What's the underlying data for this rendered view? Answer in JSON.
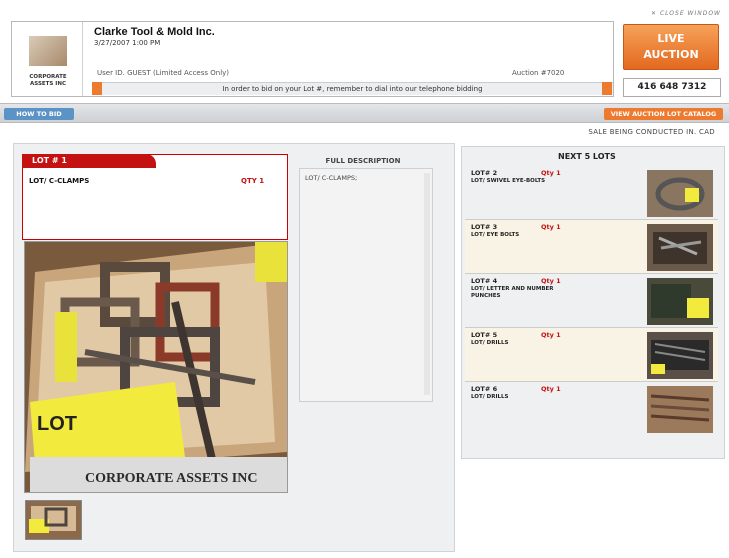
{
  "window": {
    "close_label": "✕ CLOSE WINDOW"
  },
  "header": {
    "company": "Clarke Tool & Mold Inc.",
    "datetime": "3/27/2007 1:00 PM",
    "user_id": "User ID. GUEST (Limited Access Only)",
    "auction_no": "Auction #7020",
    "notice": "In order to bid on your Lot #, remember to dial into our telephone bidding",
    "logo_name": "CORPORATE ASSETS INC",
    "live_auction_line1": "LIVE",
    "live_auction_line2": "AUCTION",
    "phone": "416 648 7312"
  },
  "nav": {
    "how_to_bid": "HOW TO BID",
    "catalog": "VIEW AUCTION LOT CATALOG",
    "sale_currency": "SALE BEING CONDUCTED IN. CAD"
  },
  "current_lot": {
    "tab": "LOT # 1",
    "name": "LOT/ C-CLAMPS",
    "qty": "QTY 1",
    "desc_title": "FULL DESCRIPTION",
    "desc_text": "LOT/  C-CLAMPS;",
    "photo_label": "LOT",
    "photo_banner": "CORPORATE ASSETS INC"
  },
  "next_lots": {
    "title": "NEXT 5 LOTS",
    "items": [
      {
        "lot": "LOT# 2",
        "qty": "Qty 1",
        "desc": "LOT/ SWIVEL EYE-BOLTS",
        "bg": "#eef0f2"
      },
      {
        "lot": "LOT# 3",
        "qty": "Qty 1",
        "desc": "LOT/ EYE BOLTS",
        "bg": "#f8f3e4"
      },
      {
        "lot": "LOT# 4",
        "qty": "Qty 1",
        "desc": "LOT/ LETTER AND NUMBER PUNCHES",
        "bg": "#eef0f2"
      },
      {
        "lot": "LOT# 5",
        "qty": "Qty 1",
        "desc": "LOT/ DRILLS",
        "bg": "#f8f3e4"
      },
      {
        "lot": "LOT# 6",
        "qty": "Qty 1",
        "desc": "LOT/ DRILLS",
        "bg": "#eef0f2"
      }
    ]
  }
}
